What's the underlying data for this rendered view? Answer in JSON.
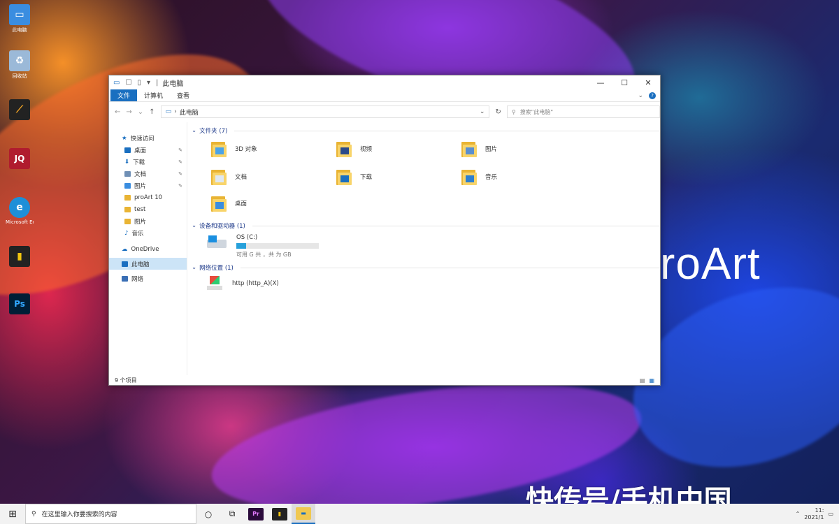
{
  "wallpaper": {
    "brand_text": "roArt",
    "watermark": "快传号/手机中国"
  },
  "desktop_icons": [
    {
      "label": "此电脑",
      "color": "#3a8de0",
      "glyph": "▭"
    },
    {
      "label": "回收站",
      "color": "#9bb9d8",
      "glyph": "♻"
    },
    {
      "label": "",
      "color": "#222222",
      "glyph": "⟋"
    },
    {
      "label": "",
      "color": "#b01c2e",
      "glyph": "JQ"
    },
    {
      "label": "Microsoft Edge",
      "color": "#1d8fd8",
      "glyph": "e"
    },
    {
      "label": "",
      "color": "#222222",
      "glyph": "▮"
    },
    {
      "label": "",
      "color": "#001e36",
      "glyph": "Ps"
    }
  ],
  "window": {
    "title": "此电脑",
    "ribbon_tabs": [
      "文件",
      "计算机",
      "查看"
    ],
    "address": "此电脑",
    "search_placeholder": "搜索\"此电脑\"",
    "nav": {
      "quick_access": "快速访问",
      "items": [
        {
          "label": "桌面",
          "color": "#1a6fc0",
          "pinned": true
        },
        {
          "label": "下载",
          "color": "#1a6fc0",
          "pinned": true
        },
        {
          "label": "文档",
          "color": "#6f8fb5",
          "pinned": true
        },
        {
          "label": "图片",
          "color": "#3a8de0",
          "pinned": true
        },
        {
          "label": "proArt 10",
          "color": "#e9b434",
          "pinned": false
        },
        {
          "label": "test",
          "color": "#e9b434",
          "pinned": false
        },
        {
          "label": "图片",
          "color": "#e9b434",
          "pinned": false
        },
        {
          "label": "音乐",
          "color": "#1a6fc0",
          "pinned": false
        }
      ],
      "onedrive": "OneDrive",
      "this_pc": "此电脑",
      "network": "网络"
    },
    "folders_group": "文件夹 (7)",
    "folders": [
      {
        "label": "3D 对象",
        "overlay": "#4aa3e8"
      },
      {
        "label": "视频",
        "overlay": "#2b4a8a"
      },
      {
        "label": "图片",
        "overlay": "#5a8fd0"
      },
      {
        "label": "文档",
        "overlay": "#dfe8f2"
      },
      {
        "label": "下载",
        "overlay": "#1a6fc0"
      },
      {
        "label": "音乐",
        "overlay": "#2d7fd0"
      },
      {
        "label": "桌面",
        "overlay": "#3a8de0"
      }
    ],
    "drives_group": "设备和驱动器 (1)",
    "drive": {
      "label": "OS (C:)",
      "detail": "可用 G 共 ，共 为 GB",
      "used_fraction": 0.12
    },
    "network_group": "网络位置 (1)",
    "network_item": "http (http_A)(X)",
    "status": "9 个项目"
  },
  "taskbar": {
    "search_placeholder": "在这里输入你要搜索的内容",
    "time": "11:",
    "date": "2021/1"
  }
}
